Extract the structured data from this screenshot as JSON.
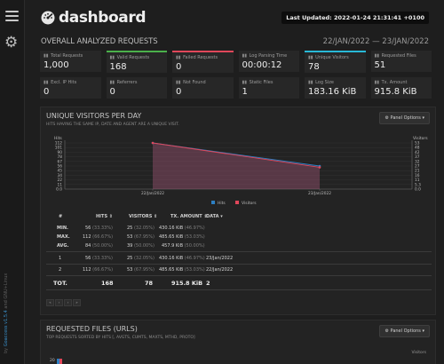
{
  "app": {
    "name": "dashboard",
    "last_updated": "Last Updated: 2022-01-24 21:31:41 +0100",
    "sidebar_credit_prefix": "by ",
    "sidebar_credit_link": "Goaccess v1.5.4",
    "sidebar_credit_suffix": " and GNU+Linux"
  },
  "overview": {
    "title": "OVERALL ANALYZED REQUESTS",
    "date_range": "22/JAN/2022 — 23/JAN/2022",
    "cards": [
      {
        "label": "Total Requests",
        "value": "1,000",
        "accent": ""
      },
      {
        "label": "Valid Requests",
        "value": "168",
        "accent": "#4bb04b"
      },
      {
        "label": "Failed Requests",
        "value": "0",
        "accent": "#e0475a"
      },
      {
        "label": "Log Parsing Time",
        "value": "00:00:12",
        "accent": ""
      },
      {
        "label": "Unique Visitors",
        "value": "78",
        "accent": "#28b8d6"
      },
      {
        "label": "Requested Files",
        "value": "51",
        "accent": ""
      },
      {
        "label": "Excl. IP Hits",
        "value": "0",
        "accent": ""
      },
      {
        "label": "Referrers",
        "value": "0",
        "accent": ""
      },
      {
        "label": "Not Found",
        "value": "0",
        "accent": ""
      },
      {
        "label": "Static Files",
        "value": "1",
        "accent": ""
      },
      {
        "label": "Log Size",
        "value": "183.16 KiB",
        "accent": ""
      },
      {
        "label": "Tx. Amount",
        "value": "915.8 KiB",
        "accent": ""
      }
    ]
  },
  "visitors_panel": {
    "title": "UNIQUE VISITORS PER DAY",
    "subtitle": "HITS HAVING THE SAME IP, DATE AND AGENT ARE A UNIQUE VISIT.",
    "options_label": "⚙ Panel Options ▾",
    "table": {
      "headers": [
        "#",
        "HITS ⇕",
        "VISITORS ⇕",
        "TX. AMOUNT ⇕",
        "DATA ▾"
      ],
      "stats": [
        {
          "label": "MIN.",
          "hits": "56",
          "hits_pct": "(33.33%)",
          "visitors": "25",
          "visitors_pct": "(32.05%)",
          "tx": "430.16 KiB",
          "tx_pct": "(46.97%)"
        },
        {
          "label": "MAX.",
          "hits": "112",
          "hits_pct": "(66.67%)",
          "visitors": "53",
          "visitors_pct": "(67.95%)",
          "tx": "485.65 KiB",
          "tx_pct": "(53.03%)"
        },
        {
          "label": "AVG.",
          "hits": "84",
          "hits_pct": "(50.00%)",
          "visitors": "39",
          "visitors_pct": "(50.00%)",
          "tx": "457.9 KiB",
          "tx_pct": "(50.00%)"
        }
      ],
      "rows": [
        {
          "n": "1",
          "hits": "56",
          "hits_pct": "(33.33%)",
          "visitors": "25",
          "visitors_pct": "(32.05%)",
          "tx": "430.16 KiB",
          "tx_pct": "(46.97%)",
          "data": "23/Jan/2022"
        },
        {
          "n": "2",
          "hits": "112",
          "hits_pct": "(66.67%)",
          "visitors": "53",
          "visitors_pct": "(67.95%)",
          "tx": "485.65 KiB",
          "tx_pct": "(53.03%)",
          "data": "22/Jan/2022"
        }
      ],
      "total": {
        "label": "TOT.",
        "hits": "168",
        "visitors": "78",
        "tx": "915.8 KiB",
        "data": "2"
      }
    },
    "pager": [
      "«",
      "‹",
      "›",
      "»"
    ]
  },
  "files_panel": {
    "title": "REQUESTED FILES (URLS)",
    "subtitle": "TOP REQUESTS SORTED BY HITS [, AVGTS, CUMTS, MAXTS, MTHD, PROTO]",
    "options_label": "⚙ Panel Options ▾",
    "chart_label_right": "Visitors",
    "chart_first_tick": "20"
  },
  "chart_data": {
    "type": "area",
    "categories": [
      "22/Jan/2022",
      "23/Jan/2022"
    ],
    "series": [
      {
        "name": "Hits",
        "values": [
          112,
          56
        ],
        "color": "#2d7fc2"
      },
      {
        "name": "Visitors",
        "values": [
          53,
          25
        ],
        "color": "#e0475a"
      }
    ],
    "left_axis_label": "Hits",
    "right_axis_label": "Visitors",
    "left_ticks": [
      "0.0",
      "11",
      "22",
      "34",
      "45",
      "56",
      "67",
      "78",
      "90",
      "101",
      "112"
    ],
    "right_ticks": [
      "0.0",
      "5.3",
      "11",
      "16",
      "21",
      "27",
      "32",
      "37",
      "42",
      "48",
      "53"
    ],
    "left_ylim": [
      0,
      112
    ],
    "right_ylim": [
      0,
      53
    ],
    "legend": "bottom-center",
    "grid": true
  }
}
